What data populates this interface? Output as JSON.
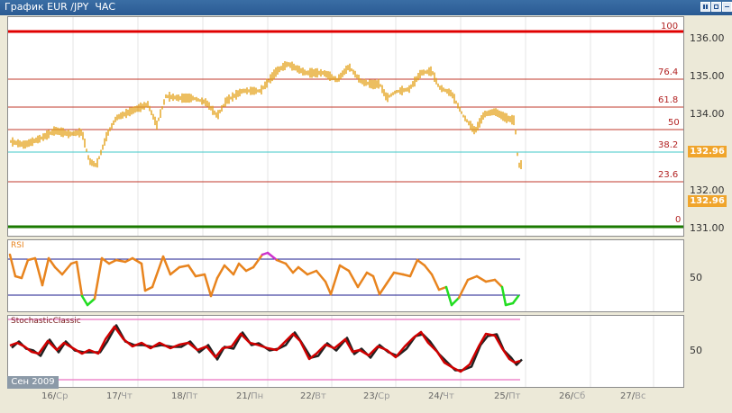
{
  "window": {
    "title": "График EUR /JPY  ЧАС",
    "buttons": [
      "pause-button",
      "restore-button",
      "close-button"
    ]
  },
  "price_axis": {
    "labels": [
      "136.00",
      "135.00",
      "134.00",
      "133.00",
      "132.00",
      "131.00"
    ],
    "current_price": "132.96",
    "current_price_badge_2": "132.96"
  },
  "fibonacci": {
    "levels": [
      "100",
      "76.4",
      "61.8",
      "50",
      "38.2",
      "23.6",
      "0"
    ]
  },
  "rsi": {
    "label": "RSI",
    "axis_label": "50"
  },
  "stochastic": {
    "label": "StochasticClassic",
    "axis_label": "50"
  },
  "time_axis": {
    "date_badge": "Сен 2009",
    "days": [
      {
        "d": "16",
        "w": "Ср"
      },
      {
        "d": "17",
        "w": "Чт"
      },
      {
        "d": "18",
        "w": "Пт"
      },
      {
        "d": "21",
        "w": "Пн"
      },
      {
        "d": "22",
        "w": "Вт"
      },
      {
        "d": "23",
        "w": "Ср"
      },
      {
        "d": "24",
        "w": "Чт"
      },
      {
        "d": "25",
        "w": "Пт"
      },
      {
        "d": "26",
        "w": "Сб"
      },
      {
        "d": "27",
        "w": "Вс"
      }
    ]
  },
  "colors": {
    "price": "#e3a31c",
    "fib_line": "#c0392b",
    "fib_100": "#e00000",
    "fib_0": "#1a7a00",
    "fib_382": "#40c8c8",
    "rsi": "#e8841e",
    "rsi_overbought": "#cc33cc",
    "rsi_oversold": "#22dd22",
    "rsi_bands": "#1a1a8c",
    "stoch_k": "#d00000",
    "stoch_d": "#222222",
    "stoch_bands": "#ee88cc"
  }
}
